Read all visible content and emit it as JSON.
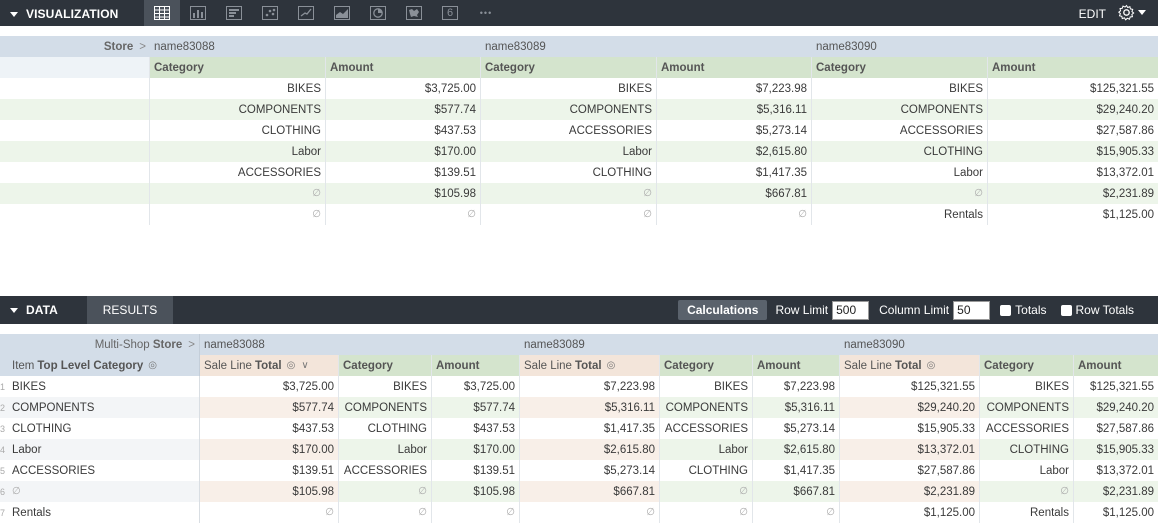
{
  "visualization": {
    "title": "VISUALIZATION",
    "edit_label": "EDIT",
    "icons": [
      "table-icon",
      "bar-chart-icon",
      "column-list-icon",
      "scatter-icon",
      "line-chart-icon",
      "area-chart-icon",
      "pie-chart-icon",
      "map-icon",
      "single-value-icon",
      "more-icon"
    ],
    "single_value_glyph": "6",
    "more_glyph": "•••",
    "pivot_label": "Store",
    "stores": [
      "name83088",
      "name83089",
      "name83090"
    ],
    "col_headers": [
      "Category",
      "Amount",
      "Category",
      "Amount",
      "Category",
      "Amount"
    ],
    "rows": [
      [
        "BIKES",
        "$3,725.00",
        "BIKES",
        "$7,223.98",
        "BIKES",
        "$125,321.55"
      ],
      [
        "COMPONENTS",
        "$577.74",
        "COMPONENTS",
        "$5,316.11",
        "COMPONENTS",
        "$29,240.20"
      ],
      [
        "CLOTHING",
        "$437.53",
        "ACCESSORIES",
        "$5,273.14",
        "ACCESSORIES",
        "$27,587.86"
      ],
      [
        "Labor",
        "$170.00",
        "Labor",
        "$2,615.80",
        "CLOTHING",
        "$15,905.33"
      ],
      [
        "ACCESSORIES",
        "$139.51",
        "CLOTHING",
        "$1,417.35",
        "Labor",
        "$13,372.01"
      ],
      [
        "∅",
        "$105.98",
        "∅",
        "$667.81",
        "∅",
        "$2,231.89"
      ],
      [
        "∅",
        "∅",
        "∅",
        "∅",
        "Rentals",
        "$1,125.00"
      ]
    ]
  },
  "data": {
    "title": "DATA",
    "results_tab": "RESULTS",
    "calculations_label": "Calculations",
    "row_limit_label": "Row Limit",
    "row_limit_value": "500",
    "column_limit_label": "Column Limit",
    "column_limit_value": "50",
    "totals_label": "Totals",
    "row_totals_label": "Row Totals",
    "pivot_prefix": "Multi-Shop",
    "pivot_label": "Store",
    "dimension_prefix": "Item",
    "dimension_label": "Top Level Category",
    "stores": [
      "name83088",
      "name83089",
      "name83090"
    ],
    "measure_prefix": "Sale Line",
    "measure_label": "Total",
    "category_label": "Category",
    "amount_label": "Amount",
    "rows": [
      {
        "n": "1",
        "dim": "BIKES",
        "cells": [
          "$3,725.00",
          "BIKES",
          "$3,725.00",
          "$7,223.98",
          "BIKES",
          "$7,223.98",
          "$125,321.55",
          "BIKES",
          "$125,321.55"
        ]
      },
      {
        "n": "2",
        "dim": "COMPONENTS",
        "cells": [
          "$577.74",
          "COMPONENTS",
          "$577.74",
          "$5,316.11",
          "COMPONENTS",
          "$5,316.11",
          "$29,240.20",
          "COMPONENTS",
          "$29,240.20"
        ]
      },
      {
        "n": "3",
        "dim": "CLOTHING",
        "cells": [
          "$437.53",
          "CLOTHING",
          "$437.53",
          "$1,417.35",
          "ACCESSORIES",
          "$5,273.14",
          "$15,905.33",
          "ACCESSORIES",
          "$27,587.86"
        ]
      },
      {
        "n": "4",
        "dim": "Labor",
        "cells": [
          "$170.00",
          "Labor",
          "$170.00",
          "$2,615.80",
          "Labor",
          "$2,615.80",
          "$13,372.01",
          "CLOTHING",
          "$15,905.33"
        ]
      },
      {
        "n": "5",
        "dim": "ACCESSORIES",
        "cells": [
          "$139.51",
          "ACCESSORIES",
          "$139.51",
          "$5,273.14",
          "CLOTHING",
          "$1,417.35",
          "$27,587.86",
          "Labor",
          "$13,372.01"
        ]
      },
      {
        "n": "6",
        "dim": "∅",
        "cells": [
          "$105.98",
          "∅",
          "$105.98",
          "$667.81",
          "∅",
          "$667.81",
          "$2,231.89",
          "∅",
          "$2,231.89"
        ]
      },
      {
        "n": "7",
        "dim": "Rentals",
        "cells": [
          "∅",
          "∅",
          "∅",
          "∅",
          "∅",
          "∅",
          "$1,125.00",
          "Rentals",
          "$1,125.00"
        ]
      }
    ]
  },
  "colors": {
    "dark_bar": "#2e343c",
    "header_blue": "#d3dde8",
    "header_green": "#d4e4cd",
    "header_peach": "#f3e5da"
  }
}
